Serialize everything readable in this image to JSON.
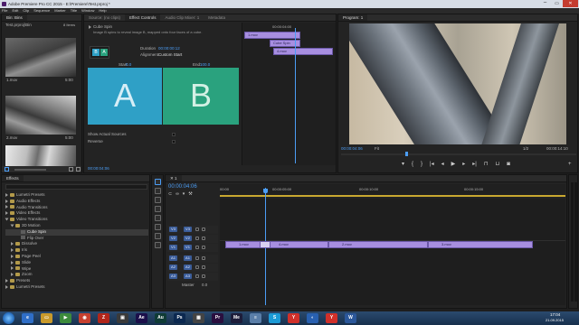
{
  "app": {
    "title": "Adobe Premiere Pro CC 2015 - E:\\Premiere\\Test.prproj *",
    "menu": [
      "File",
      "Edit",
      "Clip",
      "Sequence",
      "Marker",
      "Title",
      "Window",
      "Help"
    ]
  },
  "bin": {
    "tab": "Bin: Bins",
    "breadcrumb": "Test.prproj\\Bin",
    "count": "8 Items",
    "clips": [
      {
        "name": "1.mov",
        "duration": "5:00"
      },
      {
        "name": "2.mov",
        "duration": "5:00"
      },
      {
        "name": "3.mov",
        "duration": "5:00"
      }
    ]
  },
  "center": {
    "tabs": [
      "Source: (no clips)",
      "Effect Controls",
      "Audio Clip Mixer: 1",
      "Metadata"
    ],
    "effect_name": "Cube Spin",
    "description": "Image B spins to reveal image B, mapped onto four faces of a cube.",
    "duration_label": "Duration",
    "duration_value": "00:00:00:12",
    "alignment_label": "Alignment:",
    "alignment_value": "Custom Start",
    "start_label": "Start:",
    "start_value": "0.0",
    "end_label": "End:",
    "end_value": "100.0",
    "letter_a": "A",
    "letter_b": "B",
    "show_actual_sources": "Show Actual Sources",
    "reverse": "Reverse",
    "timecode": "00:00:04:06",
    "mini_timeline_time": "00:00:04:00",
    "clip_a": "1.mov",
    "clip_b": "4.mov",
    "clip_c": "Cube Spin",
    "colors": {
      "a": "#2fa0c6",
      "b": "#2aa27e"
    }
  },
  "program": {
    "tab": "Program: 1",
    "timecode": "00:00:04:06",
    "fit": "Fit",
    "full": "1/2",
    "duration": "00:00:14:10"
  },
  "effects": {
    "tab": "Effects",
    "items": [
      {
        "label": "Lumetri Presets",
        "level": 0,
        "type": "folder",
        "open": false
      },
      {
        "label": "Audio Effects",
        "level": 0,
        "type": "folder",
        "open": false
      },
      {
        "label": "Audio Transitions",
        "level": 0,
        "type": "folder",
        "open": false
      },
      {
        "label": "Video Effects",
        "level": 0,
        "type": "folder",
        "open": false
      },
      {
        "label": "Video Transitions",
        "level": 0,
        "type": "folder",
        "open": true
      },
      {
        "label": "3D Motion",
        "level": 1,
        "type": "folder",
        "open": true
      },
      {
        "label": "Cube Spin",
        "level": 2,
        "type": "item",
        "open": false
      },
      {
        "label": "Flip Over",
        "level": 2,
        "type": "item",
        "open": false
      },
      {
        "label": "Dissolve",
        "level": 1,
        "type": "folder",
        "open": false
      },
      {
        "label": "Iris",
        "level": 1,
        "type": "folder",
        "open": false
      },
      {
        "label": "Page Peel",
        "level": 1,
        "type": "folder",
        "open": false
      },
      {
        "label": "Slide",
        "level": 1,
        "type": "folder",
        "open": false
      },
      {
        "label": "Wipe",
        "level": 1,
        "type": "folder",
        "open": false
      },
      {
        "label": "Zoom",
        "level": 1,
        "type": "folder",
        "open": false
      },
      {
        "label": "Presets",
        "level": 0,
        "type": "folder",
        "open": false
      },
      {
        "label": "Lumetri Presets",
        "level": 0,
        "type": "folder",
        "open": false
      }
    ]
  },
  "timeline": {
    "tab": "1",
    "timecode": "00:00:04:06",
    "ruler": [
      "00:00",
      "00:00:05:00",
      "00:00:10:00",
      "00:00:15:00"
    ],
    "video_tracks": [
      "V3",
      "V2",
      "V1"
    ],
    "audio_tracks": [
      "A1",
      "A2",
      "A3"
    ],
    "master": "Master",
    "master_value": "0.0",
    "clips": [
      "1.mov",
      "4.mov",
      "2.mov",
      "3.mov"
    ]
  },
  "taskbar": {
    "time": "17:04",
    "date": "21.09.2015",
    "apps": [
      {
        "name": "ie-icon",
        "color": "#2f6ec7",
        "glyph": "e"
      },
      {
        "name": "folder-icon",
        "color": "#c99a2b",
        "glyph": "▭"
      },
      {
        "name": "player-icon",
        "color": "#3c8b3c",
        "glyph": "▶"
      },
      {
        "name": "chrome-icon",
        "color": "#c7402f",
        "glyph": "◉"
      },
      {
        "name": "filezilla-icon",
        "color": "#b1261b",
        "glyph": "Z"
      },
      {
        "name": "app-icon",
        "color": "#3a3a3a",
        "glyph": "▣"
      },
      {
        "name": "after-effects-icon",
        "color": "#1b0f4a",
        "glyph": "Ae"
      },
      {
        "name": "audition-icon",
        "color": "#0f3b36",
        "glyph": "Au"
      },
      {
        "name": "photoshop-icon",
        "color": "#0b2850",
        "glyph": "Ps"
      },
      {
        "name": "app-icon-2",
        "color": "#444",
        "glyph": "▦"
      },
      {
        "name": "premiere-icon",
        "color": "#2a0f3f",
        "glyph": "Pr"
      },
      {
        "name": "media-encoder-icon",
        "color": "#1d1d3a",
        "glyph": "Me"
      },
      {
        "name": "notepad-icon",
        "color": "#5a7ea8",
        "glyph": "≡"
      },
      {
        "name": "skype-icon",
        "color": "#1b9ad6",
        "glyph": "S"
      },
      {
        "name": "yandex-icon",
        "color": "#d0302a",
        "glyph": "Y"
      },
      {
        "name": "browser-icon",
        "color": "#2860b0",
        "glyph": "◐"
      },
      {
        "name": "yandex-icon-2",
        "color": "#d0302a",
        "glyph": "Y"
      },
      {
        "name": "word-icon",
        "color": "#2b579a",
        "glyph": "W"
      }
    ]
  }
}
